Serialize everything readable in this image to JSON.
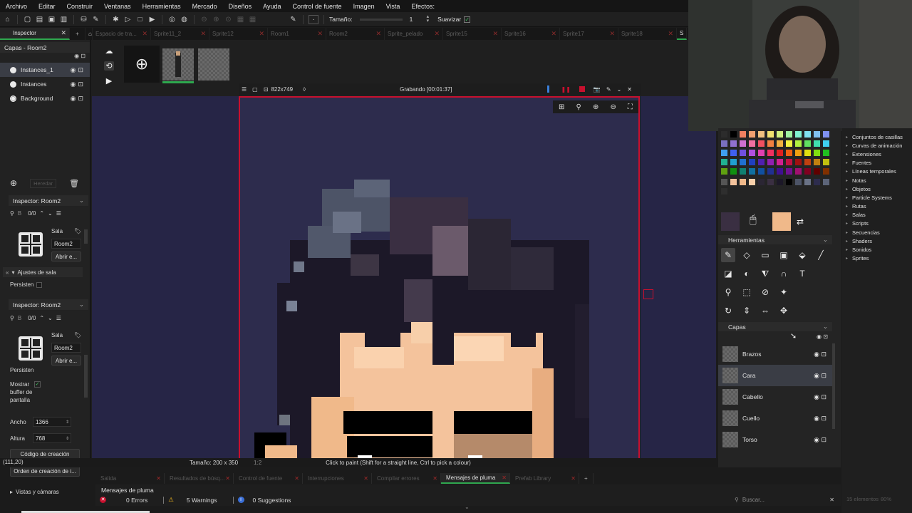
{
  "menu": [
    "Archivo",
    "Editar",
    "Construir",
    "Ventanas",
    "Herramientas",
    "Mercado",
    "Diseños",
    "Ayuda",
    "Control de fuente",
    "Imagen",
    "Vista",
    "Efectos:"
  ],
  "toolbar": {
    "size_label": "Tamaño:",
    "size_value": "1",
    "smooth_label": "Suavizar",
    "smooth_checked": true
  },
  "doc_tabs": [
    {
      "label": "Inspector",
      "active": true
    },
    {
      "label": "Espacio de tra..."
    },
    {
      "label": "Sprite11_2"
    },
    {
      "label": "Sprite12"
    },
    {
      "label": "Room1"
    },
    {
      "label": "Room2"
    },
    {
      "label": "Sprite_pelado"
    },
    {
      "label": "Sprite15"
    },
    {
      "label": "Sprite16"
    },
    {
      "label": "Sprite17"
    },
    {
      "label": "Sprite18"
    },
    {
      "label": "S"
    }
  ],
  "room_layers": {
    "header": "Capas - Room2",
    "items": [
      {
        "label": "Instances_1",
        "selected": true
      },
      {
        "label": "Instances"
      },
      {
        "label": "Background"
      }
    ],
    "inherit_button": "Heredar"
  },
  "inspector1": {
    "title": "Inspector: Room2",
    "count": "0/0",
    "type_label": "Sala",
    "name": "Room2",
    "open_button": "Abrir e...",
    "settings_header": "Ajustes de sala",
    "persistent_label": "Persisten"
  },
  "inspector2": {
    "title": "Inspector: Room2",
    "count": "0/0",
    "type_label": "Sala",
    "name": "Room2",
    "open_button": "Abrir e...",
    "persistent_label": "Persisten",
    "show_buffer_label": "Mostrar buffer de pantalla",
    "width_label": "Ancho",
    "width_value": "1366",
    "height_label": "Altura",
    "height_value": "768",
    "creation_code_button": "Código de creación",
    "creation_order_button": "Orden de creación de i...",
    "views_label": "Vistas y cámaras"
  },
  "sprite_editor": {
    "dimensions": "822x749",
    "recording": "Grabando [00:01:37]"
  },
  "palette": {
    "primary_color": "#3a2f42",
    "secondary_color": "#f0b98a"
  },
  "tools_header": "Herramientas",
  "image_layers": {
    "header": "Capas",
    "items": [
      {
        "label": "Brazos"
      },
      {
        "label": "Cara",
        "selected": true
      },
      {
        "label": "Cabello"
      },
      {
        "label": "Cuello"
      },
      {
        "label": "Torso"
      }
    ]
  },
  "resource_tree": [
    "Conjuntos de casillas",
    "Curvas de animación",
    "Extensiones",
    "Fuentes",
    "Líneas temporales",
    "Notas",
    "Objetos",
    "Particle Systems",
    "Rutas",
    "Salas",
    "Scripts",
    "Secuencias",
    "Shaders",
    "Sonidos",
    "Sprites"
  ],
  "status": {
    "coords": "(111,20)",
    "size": "Tamaño: 200 x 350",
    "zoom": "1:2",
    "hint": "Click to paint (Shift for a straight line, Ctrl to pick a colour)"
  },
  "bottom_tabs": [
    {
      "label": "Salida"
    },
    {
      "label": "Resultados de búsq..."
    },
    {
      "label": "Control de fuente"
    },
    {
      "label": "Interrupciones"
    },
    {
      "label": "Compilar errores"
    },
    {
      "label": "Mensajes de pluma",
      "active": true
    },
    {
      "label": "Prefab Library"
    }
  ],
  "bottom_panel": {
    "title": "Mensajes de pluma",
    "errors": "0 Errors",
    "warnings": "5 Warnings",
    "suggestions": "0 Suggestions",
    "search_placeholder": "Buscar...",
    "items_count": "15 elementos",
    "zoom_pct": "80%"
  }
}
